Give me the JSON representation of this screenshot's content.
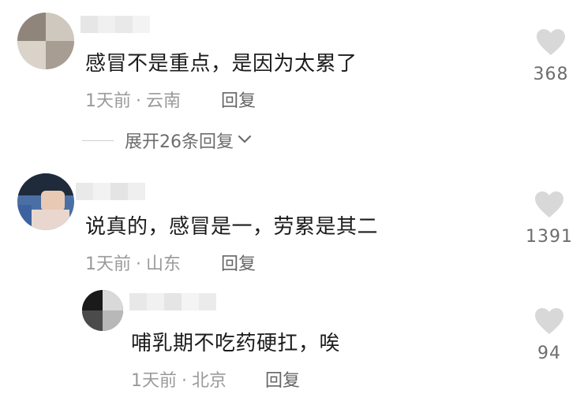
{
  "comments": [
    {
      "text": "感冒不是重点，是因为太累了",
      "time": "1天前",
      "location": "云南",
      "reply_label": "回复",
      "likes": "368",
      "expand_label": "展开26条回复"
    },
    {
      "text": "说真的，感冒是一，劳累是其二",
      "time": "1天前",
      "location": "山东",
      "reply_label": "回复",
      "likes": "1391"
    },
    {
      "text": "哺乳期不吃药硬扛，唉",
      "time": "1天前",
      "location": "北京",
      "reply_label": "回复",
      "likes": "94"
    }
  ],
  "meta_separator": "·",
  "colors": {
    "text": "#1c1c1c",
    "meta": "#9a9a9a",
    "heart": "#d8d8d8"
  },
  "icons": {
    "like": "heart-icon",
    "expand": "chevron-down-icon"
  }
}
